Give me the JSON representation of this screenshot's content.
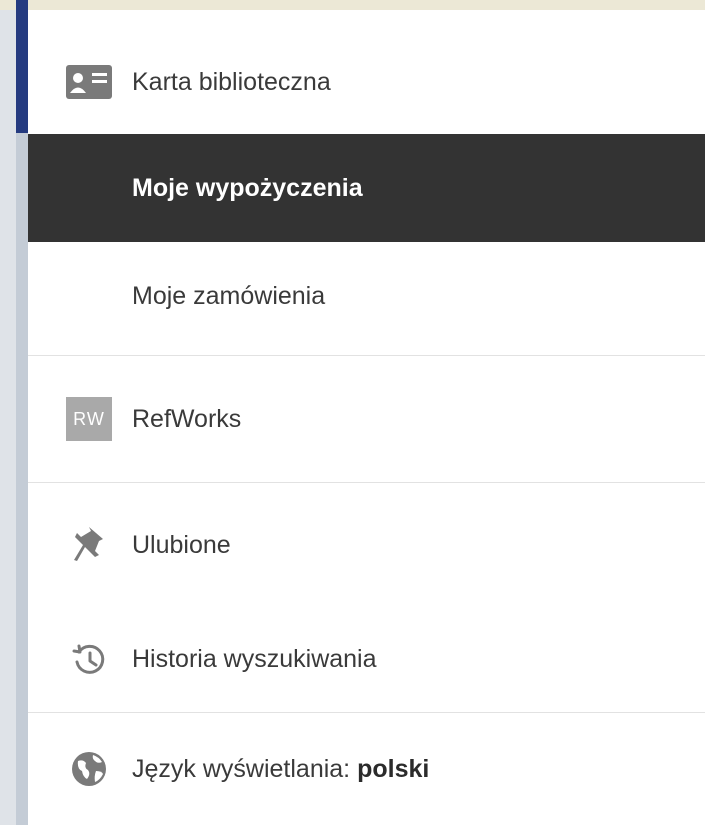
{
  "menu": {
    "items": [
      {
        "label": "Karta biblioteczna",
        "icon": "id-card-icon"
      },
      {
        "label": "Moje wypożyczenia",
        "selected": true
      },
      {
        "label": "Moje zamówienia"
      },
      {
        "label": "RefWorks",
        "icon": "refworks-icon",
        "badge": "RW"
      },
      {
        "label": "Ulubione",
        "icon": "pin-icon"
      },
      {
        "label": "Historia wyszukiwania",
        "icon": "history-icon"
      }
    ],
    "language": {
      "label": "Język wyświetlania: ",
      "value": "polski",
      "icon": "globe-icon"
    }
  },
  "colors": {
    "accent": "#253b80",
    "selected_bg": "#333333",
    "selected_text": "#ffffff",
    "text": "#3a3a3a",
    "icon": "#7a7a7a",
    "badge_bg": "#a9a9a9"
  }
}
